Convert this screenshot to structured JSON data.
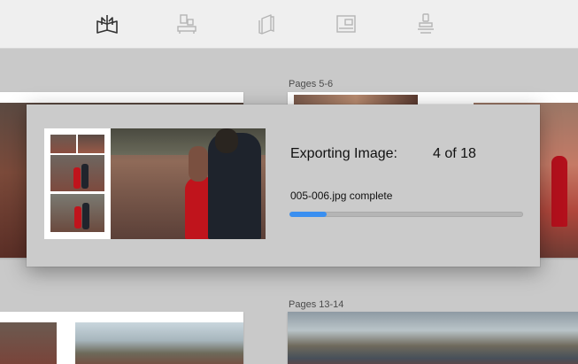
{
  "toolbar": {
    "tools": [
      {
        "icon": "book-icon",
        "active": true
      },
      {
        "icon": "layout-icon",
        "active": false
      },
      {
        "icon": "pages-icon",
        "active": false
      },
      {
        "icon": "spread-icon",
        "active": false
      },
      {
        "icon": "stamp-icon",
        "active": false
      }
    ]
  },
  "spreads": {
    "label_5_6": "Pages 5-6",
    "label_13_14": "Pages 13-14"
  },
  "export": {
    "title": "Exporting Image:",
    "count": "4 of 18",
    "status": "005-006.jpg complete",
    "progress": 0.16,
    "accent": "#3a8ff0"
  }
}
